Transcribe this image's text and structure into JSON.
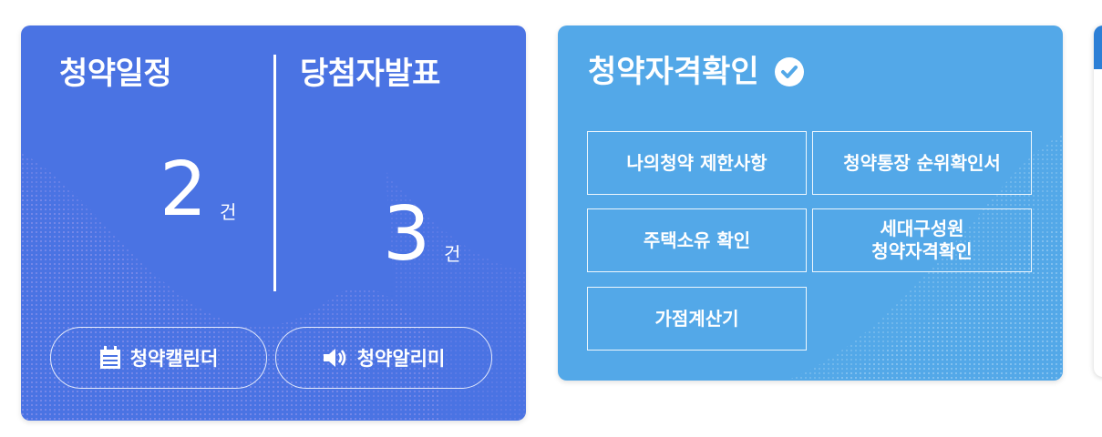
{
  "schedule_card": {
    "schedule": {
      "title": "청약일정",
      "count": "2",
      "unit": "건"
    },
    "winners": {
      "title": "당첨자발표",
      "count": "3",
      "unit": "건"
    },
    "calendar_button": "청약캘린더",
    "alarm_button": "청약알리미",
    "background_color": "#4a73e3"
  },
  "qualification_card": {
    "title": "청약자격확인",
    "buttons": [
      "나의청약 제한사항",
      "청약통장 순위확인서",
      "주택소유 확인",
      "세대구성원\n청약자격확인",
      "가점계산기"
    ],
    "background_color": "#53a8e8"
  },
  "icons": {
    "calendar": "calendar-icon",
    "speaker": "speaker-icon",
    "check": "check-circle-icon"
  }
}
